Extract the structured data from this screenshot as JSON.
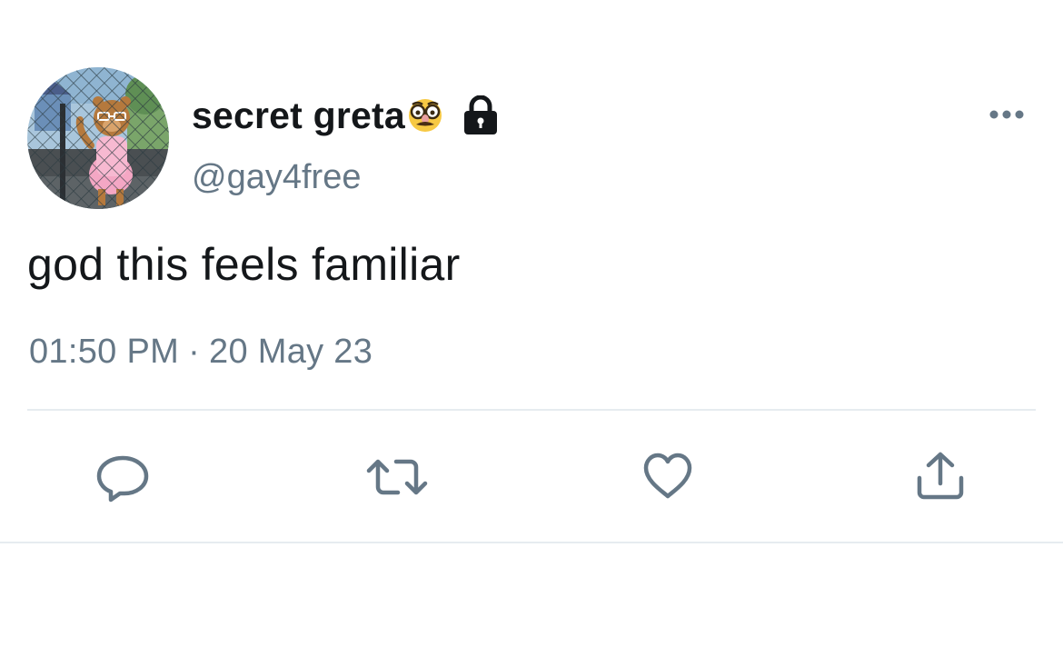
{
  "tweet": {
    "author": {
      "display_name": "secret greta",
      "handle": "@gay4free",
      "avatar_icon": "cartoon-bear-avatar",
      "name_emoji_icon": "disguise-face-icon",
      "protected_icon": "lock-icon"
    },
    "text": "god this feels familiar",
    "time": "01:50 PM",
    "separator": "·",
    "date": "20 May 23",
    "more_icon": "more-options-icon",
    "actions": [
      {
        "name": "reply",
        "icon": "reply-icon"
      },
      {
        "name": "retweet",
        "icon": "retweet-icon"
      },
      {
        "name": "like",
        "icon": "heart-icon"
      },
      {
        "name": "share",
        "icon": "share-icon"
      }
    ]
  },
  "colors": {
    "primary_text": "#14171a",
    "secondary_text": "#657786",
    "divider": "#e6ecf0",
    "icon": "#657786"
  }
}
